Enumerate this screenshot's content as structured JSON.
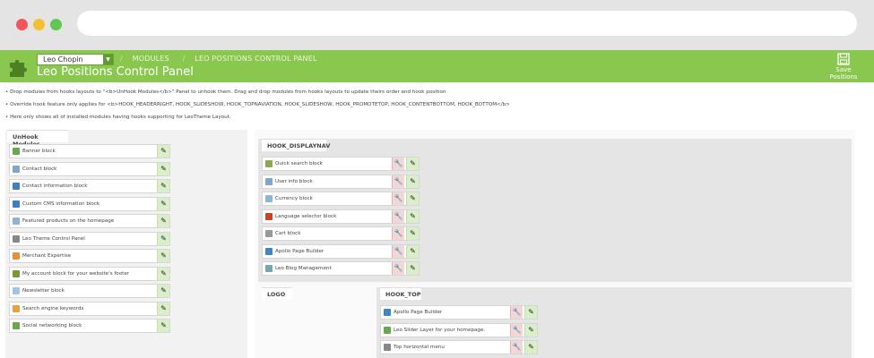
{
  "header": {
    "shop_select": "Leo Chopin",
    "breadcrumb": [
      "MODULES",
      "LEO POSITIONS CONTROL PANEL"
    ],
    "title": "Leo Positions Control Panel",
    "save_label": "Save Positions"
  },
  "notes": [
    "• Drop modules from hooks layouts to \"<b>UnHook Modules</b>\" Panel to unhook them. Drag and drop modules from hooks layouts to update theirs order and hook position",
    "• Override hook feature only applies for <b>HOOK_HEADERRIGHT, HOOK_SLIDESHOW, HOOK_TOPNAVIATION, HOOK_SLIDESHOW, HOOK_PROMOTETOP, HOOK_CONTENTBOTTOM, HOOK_BOTTOM</b>",
    "• Here only shows all of installed modules having hooks supporting for LeoTheme Layout."
  ],
  "unhook": {
    "title": "UnHook Modules",
    "modules": [
      {
        "label": "Banner block",
        "icon": "banner-icon",
        "color": "#6aa84f"
      },
      {
        "label": "Contact block",
        "icon": "contact-icon",
        "color": "#7fa7c9"
      },
      {
        "label": "Contact information block",
        "icon": "info-icon",
        "color": "#3b7fc4"
      },
      {
        "label": "Custom CMS information block",
        "icon": "info-icon",
        "color": "#3b7fc4"
      },
      {
        "label": "Featured products on the homepage",
        "icon": "featured-icon",
        "color": "#8fb3d9"
      },
      {
        "label": "Leo Theme Control Panel",
        "icon": "leo-icon",
        "color": "#888888"
      },
      {
        "label": "Merchant Expertise",
        "icon": "merchant-icon",
        "color": "#e69138"
      },
      {
        "label": "My account block for your website's footer",
        "icon": "account-icon",
        "color": "#7a9a3a"
      },
      {
        "label": "Newsletter block",
        "icon": "newsletter-icon",
        "color": "#9fc5e8"
      },
      {
        "label": "Search engine keywords",
        "icon": "search-icon",
        "color": "#e6a23c"
      },
      {
        "label": "Social networking block",
        "icon": "social-icon",
        "color": "#6aa84f"
      }
    ]
  },
  "hooks": {
    "displaynav": {
      "title": "HOOK_DISPLAYNAV",
      "modules": [
        {
          "label": "Quick search block",
          "icon": "search-icon",
          "color": "#8aa84f"
        },
        {
          "label": "User info block",
          "icon": "user-icon",
          "color": "#7fa7c9"
        },
        {
          "label": "Currency block",
          "icon": "currency-icon",
          "color": "#8fb3d9"
        },
        {
          "label": "Language selector block",
          "icon": "flag-icon",
          "color": "#cc4125"
        },
        {
          "label": "Cart block",
          "icon": "cart-icon",
          "color": "#999999"
        },
        {
          "label": "Apollo Page Builder",
          "icon": "apollo-icon",
          "color": "#3d85c6"
        },
        {
          "label": "Leo Blog Management",
          "icon": "blog-icon",
          "color": "#76a5af"
        }
      ]
    },
    "logo": {
      "title": "LOGO"
    },
    "top": {
      "title": "HOOK_TOP",
      "modules": [
        {
          "label": "Apollo Page Builder",
          "icon": "apollo-icon",
          "color": "#3d85c6"
        },
        {
          "label": "Leo Slider Layer for your homepage.",
          "icon": "slider-icon",
          "color": "#6aa84f"
        },
        {
          "label": "Top horizontal menu",
          "icon": "menu-icon",
          "color": "#888888"
        }
      ]
    }
  },
  "colors": {
    "header": "#8ac74f",
    "edit": "#d9efc8",
    "wrench": "#f5d6d6"
  }
}
